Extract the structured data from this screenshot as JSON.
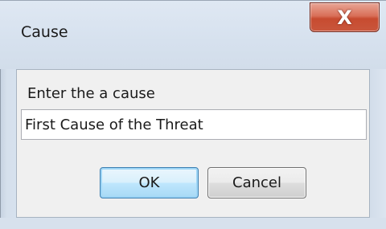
{
  "window": {
    "title": "Cause",
    "close_glyph": "X"
  },
  "dialog": {
    "prompt": "Enter the a cause",
    "input_value": "First Cause of the Threat",
    "ok_label": "OK",
    "cancel_label": "Cancel"
  },
  "colors": {
    "close_button": "#c74b30",
    "ok_button_border": "#3c7fb1",
    "client_background": "#f0f0f0",
    "frame": "#d6e1ee"
  },
  "icons": {
    "close": "close-icon"
  }
}
